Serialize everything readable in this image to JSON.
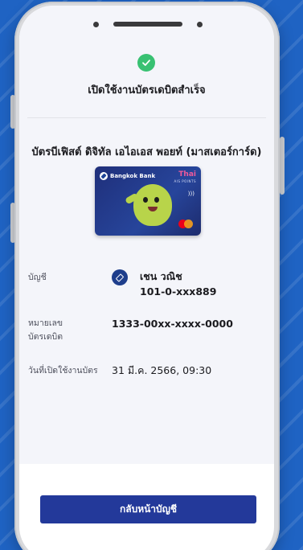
{
  "status": {
    "title": "เปิดใช้งานบัตรเดบิตสำเร็จ",
    "icon": "check-circle-icon",
    "color": "#38c172"
  },
  "card": {
    "name": "บัตรบีเฟิสต์ ดิจิทัล เอไอเอส พอยท์ (มาสเตอร์การ์ด)",
    "bank_logo_text": "Bangkok Bank",
    "partner_logo_text": "Thai",
    "partner_sub_text": "AIS POINTS"
  },
  "details": {
    "account_label": "บัญชี",
    "account_name": "เชน วณิช",
    "account_number": "101-0-xxx889",
    "card_number_label_line1": "หมายเลข",
    "card_number_label_line2": "บัตรเดบิต",
    "card_number": "1333-00xx-xxxx-0000",
    "activation_date_label": "วันที่เปิดใช้งานบัตร",
    "activation_date": "31 มี.ค. 2566, 09:30"
  },
  "actions": {
    "back_label": "กลับหน้าบัญชี"
  },
  "colors": {
    "background": "#1f63c3",
    "primary_button": "#23399a",
    "success": "#38c172"
  }
}
